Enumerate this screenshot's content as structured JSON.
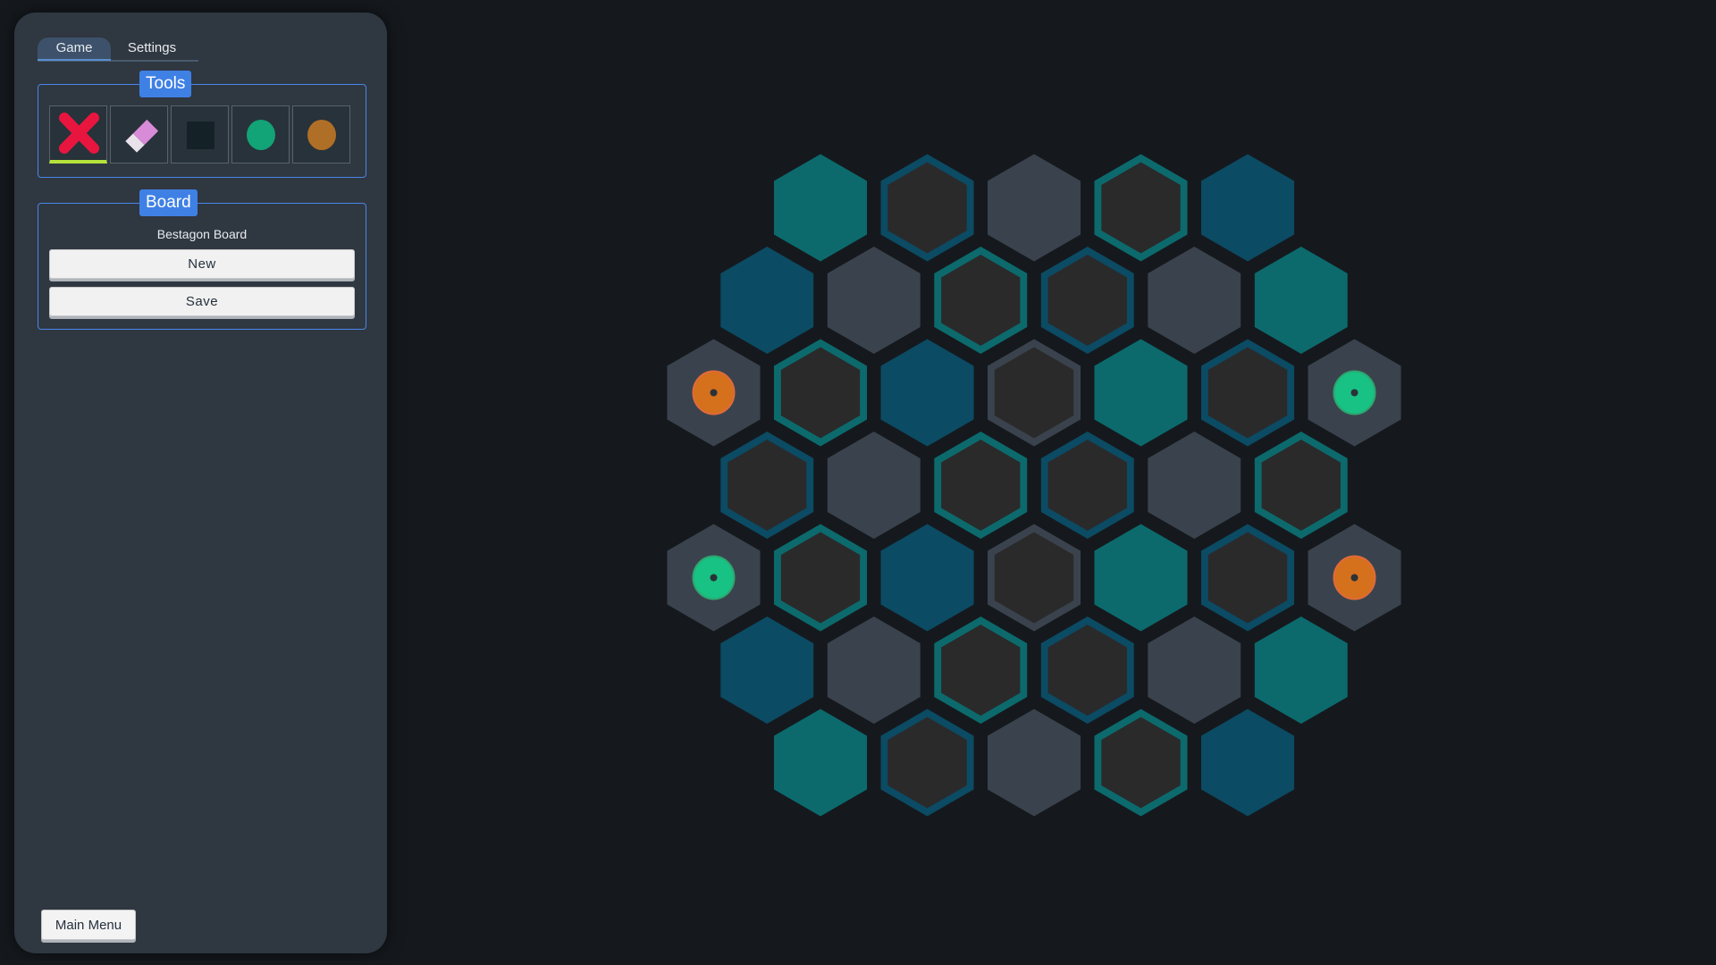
{
  "tabs": [
    {
      "label": "Game",
      "active": true
    },
    {
      "label": "Settings",
      "active": false
    }
  ],
  "tools": {
    "title": "Tools",
    "items": [
      {
        "name": "close-icon",
        "selected": true
      },
      {
        "name": "eraser-icon",
        "selected": false
      },
      {
        "name": "square-icon",
        "selected": false
      },
      {
        "name": "green-disc-icon",
        "selected": false
      },
      {
        "name": "orange-disc-icon",
        "selected": false
      }
    ]
  },
  "board_panel": {
    "title": "Board",
    "board_name": "Bestagon Board",
    "new_label": "New",
    "save_label": "Save"
  },
  "main_menu_label": "Main Menu",
  "colors": {
    "background": "#15191d",
    "panel": "#2f3741",
    "accent": "#3f80e5",
    "teal": "#0c6a6d",
    "blue": "#0b4b64",
    "gray": "#3a434d",
    "dark": "#2a2a2b",
    "green_piece": "#18c184",
    "orange_piece": "#d5701d"
  },
  "board": {
    "rows": [
      [
        "T",
        "dB",
        "G",
        "dT",
        "B"
      ],
      [
        "B",
        "G",
        "dT",
        "dB",
        "G",
        "T"
      ],
      [
        "G:orange",
        "dT",
        "B",
        "dG",
        "T",
        "dB",
        "G:green"
      ],
      [
        "dB",
        "G",
        "dT",
        "dB",
        "G",
        "dT"
      ],
      [
        "G:green",
        "dT",
        "B",
        "dG",
        "T",
        "dB",
        "G:orange"
      ],
      [
        "B",
        "G",
        "dT",
        "dB",
        "G",
        "T"
      ],
      [
        "T",
        "dB",
        "G",
        "dT",
        "B"
      ]
    ]
  }
}
